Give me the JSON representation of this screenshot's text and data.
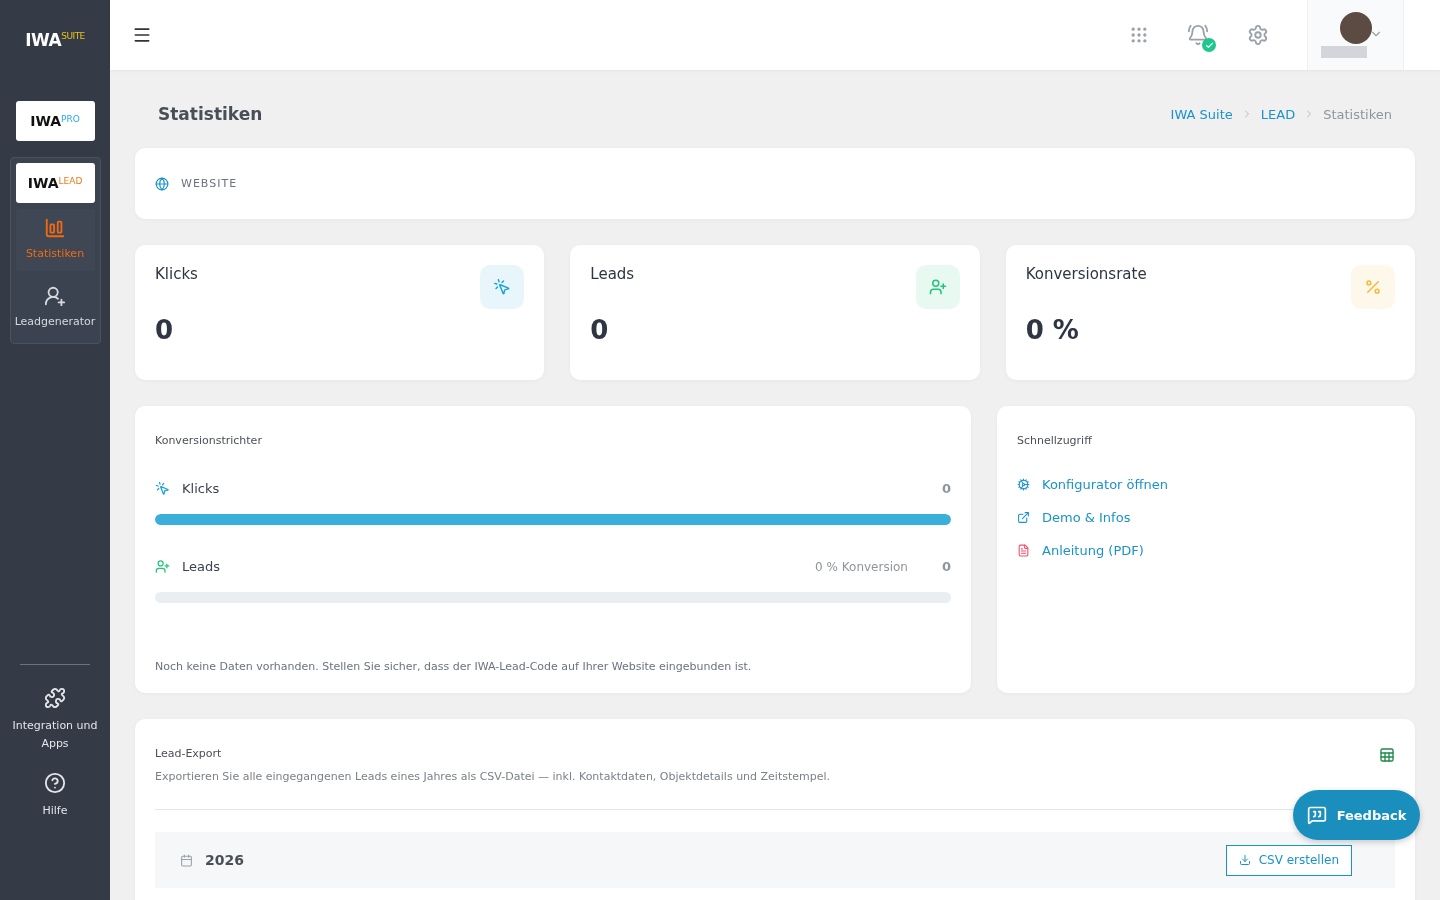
{
  "sidebar": {
    "logo": {
      "brand": "IWA",
      "suffix": "SUITE"
    },
    "products": [
      {
        "brand": "IWA",
        "suffix": "PRO",
        "expanded": false
      },
      {
        "brand": "IWA",
        "suffix": "LEAD",
        "expanded": true,
        "items": [
          {
            "kind": "stats",
            "label": "Statistiken",
            "selected": true
          },
          {
            "kind": "lead",
            "label": "Leadgenerator",
            "selected": false
          }
        ]
      }
    ],
    "bottom": [
      {
        "kind": "puzzle",
        "label": "Integration und Apps"
      },
      {
        "kind": "help",
        "label": "Hilfe"
      }
    ]
  },
  "header": {
    "notification_ok": true
  },
  "page": {
    "title": "Statistiken",
    "breadcrumb": [
      {
        "label": "IWA Suite",
        "link": true
      },
      {
        "label": "LEAD",
        "link": true
      },
      {
        "label": "Statistiken",
        "link": false
      }
    ]
  },
  "source": {
    "label": "WEBSITE"
  },
  "stats": [
    {
      "kind": "clicks",
      "label": "Klicks",
      "value": "0",
      "color": "#1aa3d6"
    },
    {
      "kind": "leads",
      "label": "Leads",
      "value": "0",
      "color": "#22c47a"
    },
    {
      "kind": "rate",
      "label": "Konversionsrate",
      "value": "0 %",
      "color": "#f6b93b"
    }
  ],
  "funnel": {
    "title": "Konversionstrichter",
    "rows": [
      {
        "kind": "clicks",
        "label": "Klicks",
        "count": "0",
        "level": 1
      },
      {
        "kind": "leads",
        "label": "Leads",
        "note": "0 % Konversion",
        "count": "0",
        "level": 0
      }
    ],
    "hint": "Noch keine Daten vorhanden. Stellen Sie sicher, dass der IWA-Lead-Code auf Ihrer Website eingebunden ist."
  },
  "quick_access": {
    "title": "Schnellzugriff",
    "links": [
      {
        "kind": "config",
        "label": "Konfigurator öffnen"
      },
      {
        "kind": "external",
        "label": "Demo & Infos"
      },
      {
        "kind": "pdf",
        "label": "Anleitung (PDF)"
      }
    ]
  },
  "export": {
    "title": "Lead-Export",
    "description": "Exportieren Sie alle eingegangenen Leads eines Jahres als CSV-Datei — inkl. Kontaktdaten, Objektdetails und Zeitstempel.",
    "years": [
      {
        "year": "2026",
        "button": "CSV erstellen"
      }
    ]
  },
  "feedback": {
    "label": "Feedback"
  }
}
